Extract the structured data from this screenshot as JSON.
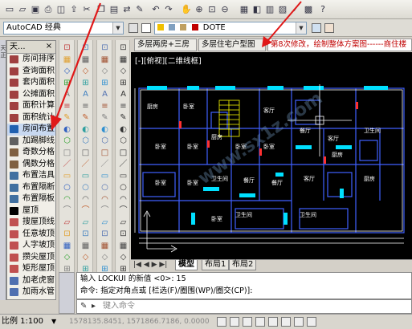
{
  "toolbar1": {
    "icons": [
      "new-icon",
      "open-icon",
      "save-icon",
      "plot-icon",
      "preview-icon",
      "publish-icon",
      "cut-icon",
      "copy-icon",
      "paste-icon",
      "match-icon",
      "brush-icon",
      "undo-icon",
      "redo-icon",
      "pan-icon",
      "zoom-realtime-icon",
      "zoom-window-icon",
      "zoom-previous-icon",
      "properties-icon",
      "design-center-icon",
      "tool-palette-icon",
      "sheet-set-icon",
      "markup-icon",
      "calc-icon",
      "help-icon"
    ]
  },
  "toolbar2": {
    "workspace_value": "AutoCAD 经典",
    "layer_value": "DOTE",
    "layer_color": "#c00000"
  },
  "panel": {
    "title": "天...",
    "items": [
      {
        "label": "房间排序",
        "color": "#a04040"
      },
      {
        "label": "查询面积",
        "color": "#a04040"
      },
      {
        "label": "套内面积",
        "color": "#a04040"
      },
      {
        "label": "公摊面积",
        "color": "#a04040"
      },
      {
        "label": "面积计算",
        "color": "#a04040"
      },
      {
        "label": "面积统计",
        "color": "#a04040"
      },
      {
        "label": "房间布置",
        "color": "#2060b0"
      },
      {
        "label": "加踢脚线",
        "color": "#606060"
      },
      {
        "label": "奇数分格",
        "color": "#806040"
      },
      {
        "label": "偶数分格",
        "color": "#806040"
      },
      {
        "label": "布置洁具",
        "color": "#4070a0"
      },
      {
        "label": "布置隔断",
        "color": "#4070a0"
      },
      {
        "label": "布置隔板",
        "color": "#4070a0"
      },
      {
        "label": "屋顶",
        "color": "#000000"
      },
      {
        "label": "搜屋顶线",
        "color": "#c05050"
      },
      {
        "label": "任意坡顶",
        "color": "#c05050"
      },
      {
        "label": "人字坡顶",
        "color": "#c05050"
      },
      {
        "label": "攒尖屋顶",
        "color": "#c05050"
      },
      {
        "label": "矩形屋顶",
        "color": "#c05050"
      },
      {
        "label": "加老虎窗",
        "color": "#5070b0"
      },
      {
        "label": "加雨水管",
        "color": "#5070b0"
      }
    ]
  },
  "drawing": {
    "tabs": [
      {
        "label": "多层两房+三房",
        "active": false
      },
      {
        "label": "多层住宅户型图",
        "active": false
      },
      {
        "label": "第8次修改，绘制整体方案图------商住楼",
        "active": true
      }
    ],
    "viewport_label": "[-][俯视][二维线框]",
    "room_labels": [
      "厨房",
      "厨房",
      "客厅",
      "餐厅",
      "卧室",
      "卧室",
      "卧室",
      "卧室",
      "厨房",
      "卧室",
      "餐厅",
      "卫生间",
      "卫生间",
      "卫生间",
      "卫生间",
      "客厅",
      "卧室",
      "卧室",
      "餐厅",
      "厨房",
      "客厅",
      "卧室"
    ]
  },
  "layout_tabs": [
    {
      "label": "模型",
      "active": true
    },
    {
      "label": "布局1",
      "active": false
    },
    {
      "label": "布局2",
      "active": false
    }
  ],
  "command": {
    "line1": "输入 LOCKUI 的新值 <0>: 15",
    "line2": "命令: 指定对角点或 [栏选(F)/圈围(WP)/圈交(CP)]:",
    "placeholder": "键入命令"
  },
  "statusbar": {
    "scale": "比例 1:100",
    "coords": "1578135.8451, 1571866.7186, 0.0000"
  },
  "watermark": "www.sx1z.com"
}
